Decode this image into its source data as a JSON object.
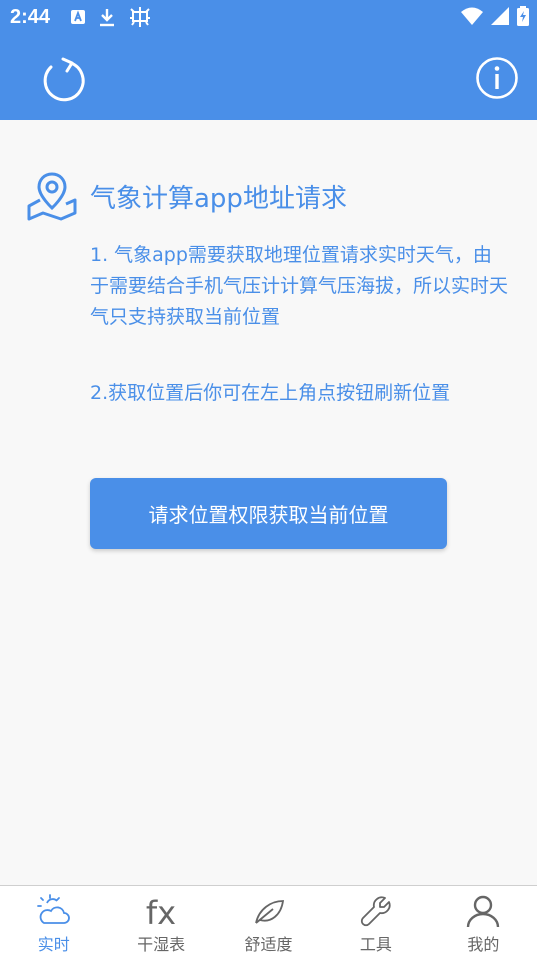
{
  "status_bar": {
    "time": "2:44",
    "left_icons": [
      "app-notification-icon",
      "download-icon",
      "bug-icon"
    ],
    "right_icons": [
      "wifi-icon",
      "signal-icon",
      "battery-charging-icon"
    ]
  },
  "app_bar": {
    "background": "#4a8fe8",
    "left_icon": "refresh-icon",
    "right_icon": "info-icon"
  },
  "request": {
    "title": "气象计算app地址请求",
    "para1": "1. 气象app需要获取地理位置请求实时天气，由于需要结合手机气压计计算气压海拔，所以实时天气只支持获取当前位置",
    "para2": "2.获取位置后你可在左上角点按钮刷新位置",
    "button_label": "请求位置权限获取当前位置"
  },
  "bottom_nav": {
    "items": [
      {
        "label": "实时",
        "icon": "weather-sun-cloud-icon",
        "active": true
      },
      {
        "label": "干湿表",
        "icon": "fx-icon",
        "active": false
      },
      {
        "label": "舒适度",
        "icon": "leaf-icon",
        "active": false
      },
      {
        "label": "工具",
        "icon": "wrench-icon",
        "active": false
      },
      {
        "label": "我的",
        "icon": "person-icon",
        "active": false
      }
    ]
  }
}
